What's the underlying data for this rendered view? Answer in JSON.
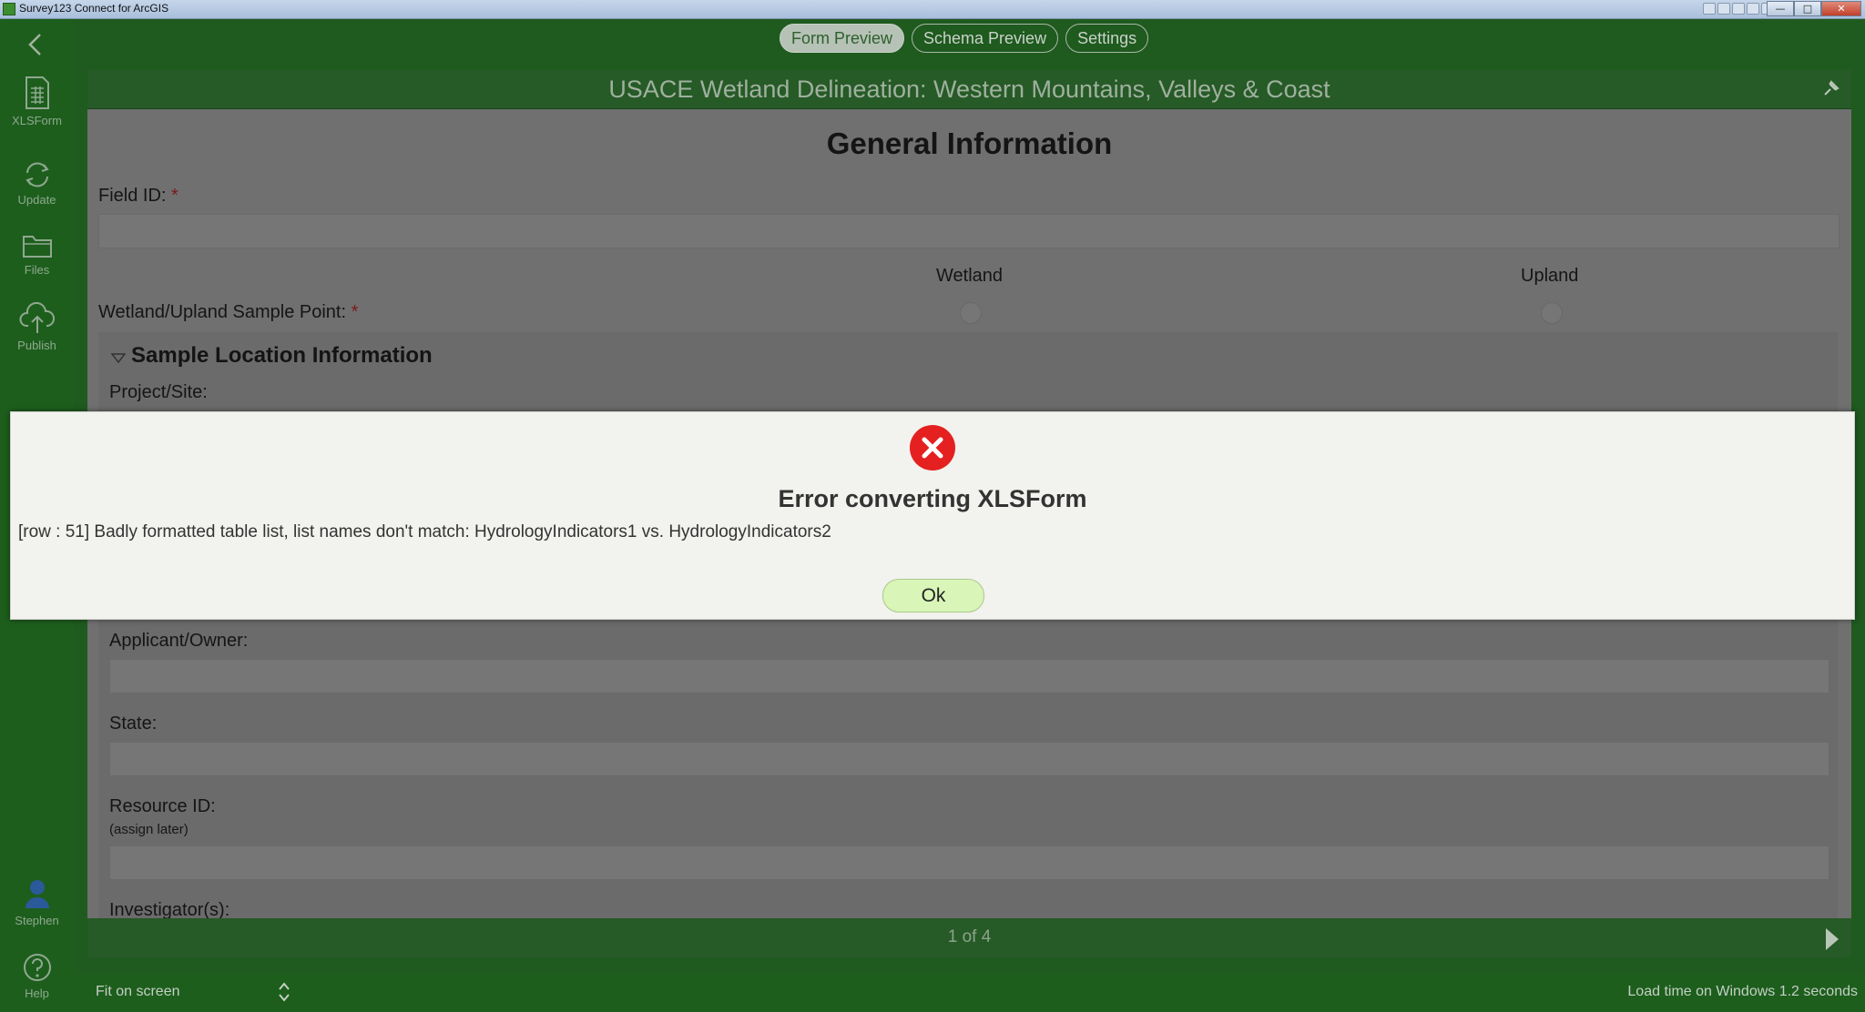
{
  "window": {
    "title": "Survey123 Connect for ArcGIS",
    "controls": {
      "minimize": "—",
      "maximize": "□",
      "close": "✕"
    }
  },
  "sidebar": {
    "items": [
      {
        "label": "XLSForm",
        "icon": "spreadsheet-icon"
      },
      {
        "label": "Update",
        "icon": "refresh-icon"
      },
      {
        "label": "Files",
        "icon": "folder-icon"
      },
      {
        "label": "Publish",
        "icon": "cloud-upload-icon"
      },
      {
        "label": "Stephen",
        "icon": "user-icon"
      },
      {
        "label": "Help",
        "icon": "help-icon"
      }
    ]
  },
  "tabs": [
    {
      "label": "Form Preview",
      "active": true
    },
    {
      "label": "Schema Preview",
      "active": false
    },
    {
      "label": "Settings",
      "active": false
    }
  ],
  "form": {
    "header_title": "USACE Wetland Delineation: Western Mountains, Valleys & Coast",
    "section_title": "General Information",
    "field_id_label": "Field ID:",
    "required_marker": "*",
    "sample_point_label": "Wetland/Upland Sample Point:",
    "option_wetland": "Wetland",
    "option_upland": "Upland",
    "group_title": "Sample Location Information",
    "project_site_label": "Project/Site:",
    "applicant_label": "Applicant/Owner:",
    "state_label": "State:",
    "resource_id_label": "Resource ID:",
    "resource_id_hint": "(assign later)",
    "investigators_label": "Investigator(s):",
    "page_indicator": "1 of 4"
  },
  "statusbar": {
    "fit_label": "Fit on screen",
    "load_time": "Load time on Windows 1.2 seconds"
  },
  "dialog": {
    "title": "Error converting XLSForm",
    "message": "[row : 51] Badly formatted table list, list names don't match: HydrologyIndicators1 vs. HydrologyIndicators2",
    "ok_label": "Ok"
  }
}
